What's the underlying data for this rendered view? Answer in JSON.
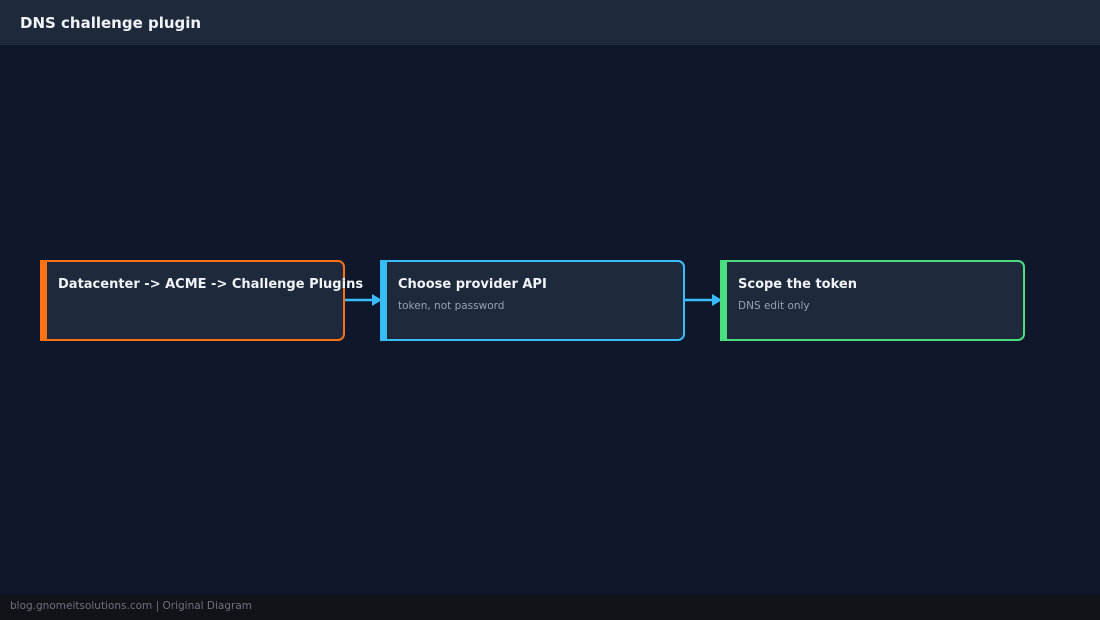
{
  "header": {
    "title": "DNS challenge plugin"
  },
  "nodes": [
    {
      "title": "Datacenter -> ACME -> Challenge Plugins",
      "subtitle": "",
      "color": "#f97316"
    },
    {
      "title": "Choose provider API",
      "subtitle": "token, not password",
      "color": "#38bdf8"
    },
    {
      "title": "Scope the token",
      "subtitle": "DNS edit only",
      "color": "#4ade80"
    }
  ],
  "edge_color": "#38bdf8",
  "footer": {
    "text": "blog.gnomeitsolutions.com | Original Diagram"
  }
}
